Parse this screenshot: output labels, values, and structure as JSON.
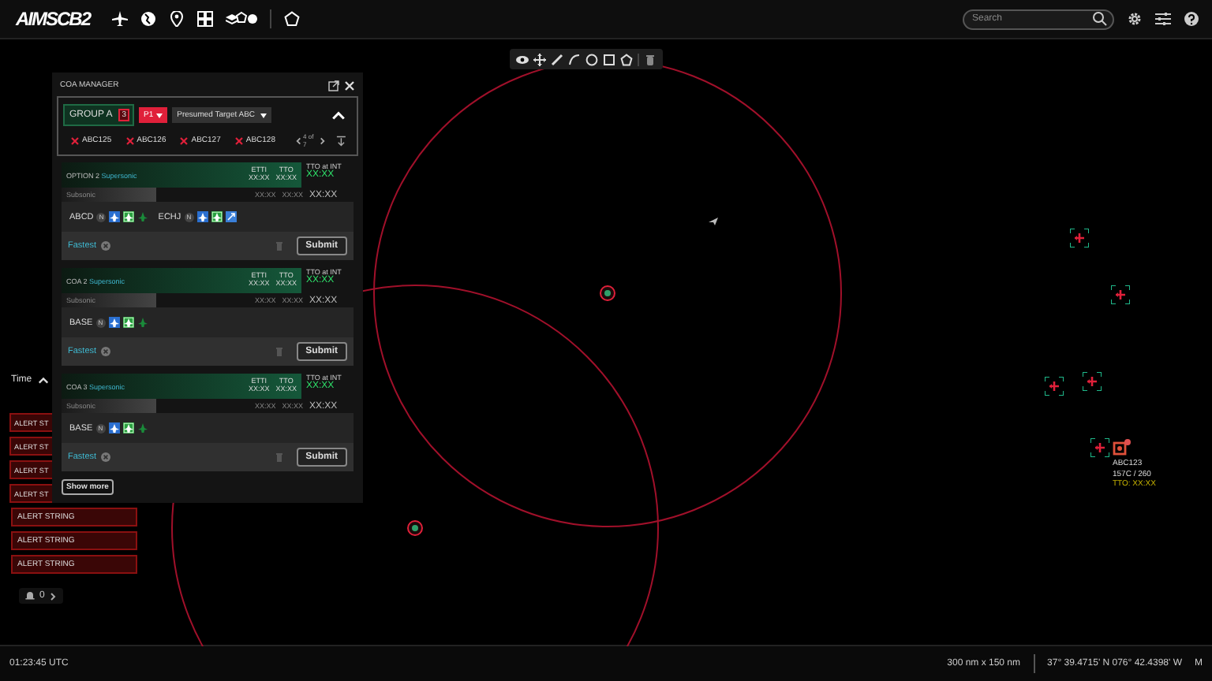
{
  "top_bar": {
    "logo": "AIMSCB2",
    "search": {
      "placeholder": "Search"
    }
  },
  "coa_manager": {
    "title": "COA MANAGER",
    "group": {
      "label": "GROUP A",
      "count": "3"
    },
    "priority": "P1",
    "target": "Presumed Target ABC",
    "tracks": [
      "ABC125",
      "ABC126",
      "ABC127",
      "ABC128"
    ],
    "pager": "4 of 7",
    "options": [
      {
        "name": "OPTION 2",
        "speed": "Supersonic",
        "etti_label": "ETTI",
        "etti": "XX:XX",
        "tto_label": "TTO",
        "tto": "XX:XX",
        "tto_int_label": "TTO at INT",
        "tto_int": "XX:XX",
        "sub_label": "Subsonic",
        "sub_times": [
          "XX:XX",
          "XX:XX"
        ],
        "sub_total": "XX:XX",
        "assets": [
          {
            "name": "ABCD",
            "badge": "N",
            "units": [
              {
                "kind": "friendly"
              },
              {
                "kind": "ready"
              },
              {
                "kind": "bare"
              }
            ]
          },
          {
            "name": "ECHJ",
            "badge": "N",
            "units": [
              {
                "kind": "friendly"
              },
              {
                "kind": "ready"
              },
              {
                "kind": "linked"
              }
            ]
          }
        ],
        "tag": "Fastest",
        "submit": "Submit"
      },
      {
        "name": "COA 2",
        "speed": "Supersonic",
        "etti_label": "ETTI",
        "etti": "XX:XX",
        "tto_label": "TTO",
        "tto": "XX:XX",
        "tto_int_label": "TTO at INT",
        "tto_int": "XX:XX",
        "sub_label": "Subsonic",
        "sub_times": [
          "XX:XX",
          "XX:XX"
        ],
        "sub_total": "XX:XX",
        "assets": [
          {
            "name": "BASE",
            "badge": "N",
            "units": [
              {
                "kind": "friendly"
              },
              {
                "kind": "ready"
              },
              {
                "kind": "bare"
              }
            ]
          }
        ],
        "tag": "Fastest",
        "submit": "Submit"
      },
      {
        "name": "COA 3",
        "speed": "Supersonic",
        "etti_label": "ETTI",
        "etti": "XX:XX",
        "tto_label": "TTO",
        "tto": "XX:XX",
        "tto_int_label": "TTO at INT",
        "tto_int": "XX:XX",
        "sub_label": "Subsonic",
        "sub_times": [
          "XX:XX",
          "XX:XX"
        ],
        "sub_total": "XX:XX",
        "assets": [
          {
            "name": "BASE",
            "badge": "N",
            "units": [
              {
                "kind": "friendly"
              },
              {
                "kind": "ready"
              },
              {
                "kind": "bare"
              }
            ]
          }
        ],
        "tag": "Fastest",
        "submit": "Submit"
      }
    ],
    "show_more": "Show more"
  },
  "alerts": {
    "header": "Time",
    "items": [
      {
        "text": "ALERT ST",
        "kind": "clipped"
      },
      {
        "text": "ALERT ST",
        "kind": "clipped"
      },
      {
        "text": "ALERT ST",
        "kind": "clipped"
      },
      {
        "text": "ALERT ST",
        "kind": "clipped"
      },
      {
        "text": "ALERT STRING",
        "kind": "full"
      },
      {
        "text": "ALERT STRING",
        "kind": "full"
      },
      {
        "text": "ALERT STRING",
        "kind": "full"
      }
    ],
    "bell_count": "0"
  },
  "map": {
    "track_label": {
      "id": "ABC123",
      "course": "157C / 260",
      "tto": "TTO: XX:XX"
    }
  },
  "status_bar": {
    "time": "01:23:45 UTC",
    "scale": "300 nm x 150 nm",
    "coordinates": "37° 39.4715' N 076° 42.4398' W",
    "unit": "M"
  }
}
